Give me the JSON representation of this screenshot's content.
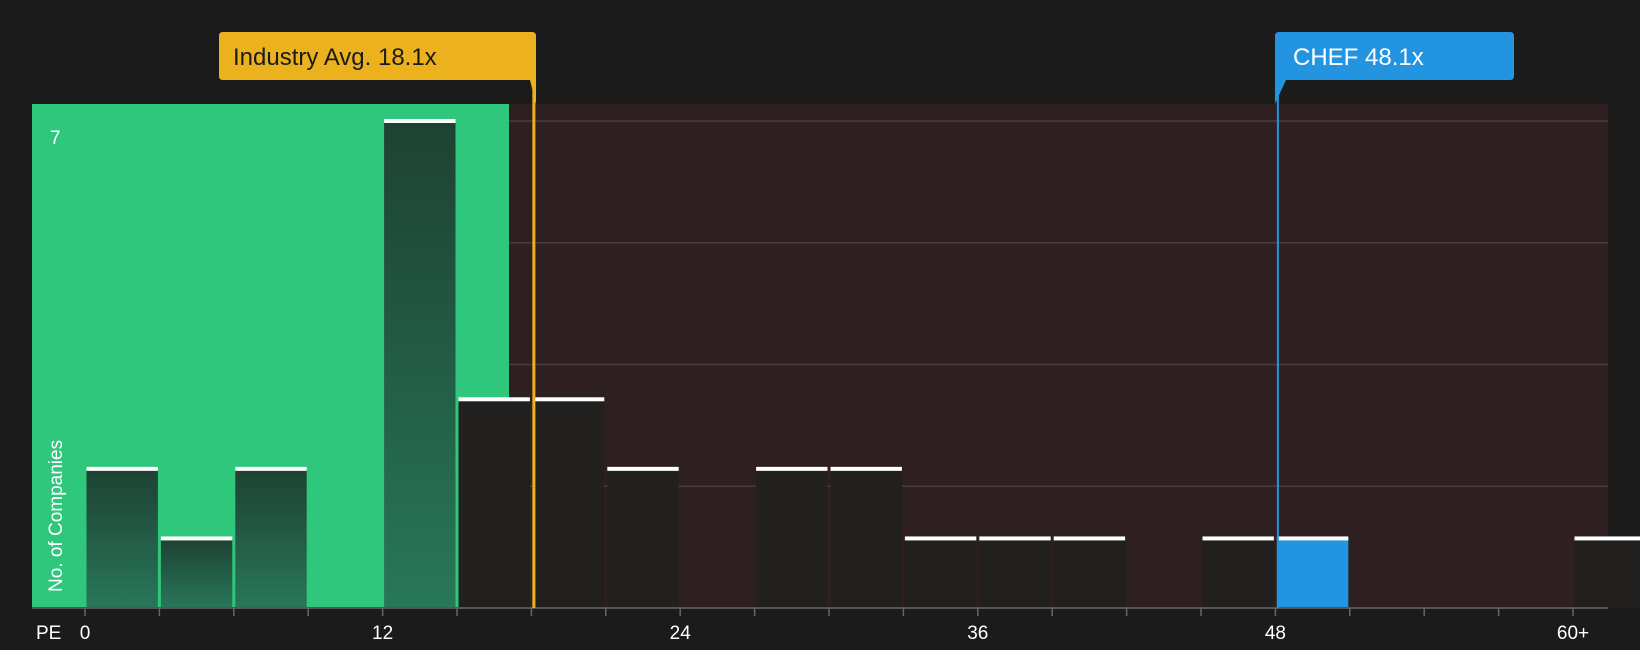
{
  "chart_data": {
    "type": "bar",
    "x_axis_title": "PE",
    "y_axis_title": "No. of Companies",
    "y_max_label": "7",
    "x_ticks": [
      "0",
      "12",
      "24",
      "36",
      "48",
      "60+"
    ],
    "bin_width": 3,
    "ylim": [
      0,
      7
    ],
    "bins": [
      {
        "start": 0,
        "count": 2
      },
      {
        "start": 3,
        "count": 1
      },
      {
        "start": 6,
        "count": 2
      },
      {
        "start": 12,
        "count": 7
      },
      {
        "start": 15,
        "count": 3
      },
      {
        "start": 18,
        "count": 3
      },
      {
        "start": 21,
        "count": 2
      },
      {
        "start": 27,
        "count": 2
      },
      {
        "start": 30,
        "count": 2
      },
      {
        "start": 33,
        "count": 1
      },
      {
        "start": 36,
        "count": 1
      },
      {
        "start": 39,
        "count": 1
      },
      {
        "start": 45,
        "count": 1
      },
      {
        "start": 48,
        "count": 1,
        "highlight": true
      },
      {
        "start": 60,
        "count": 1
      }
    ],
    "industry_avg": {
      "label": "Industry Avg. 18.1x",
      "value": 18.1
    },
    "company": {
      "label": "CHEF 48.1x",
      "value": 48.1
    },
    "colors": {
      "background": "#1b1b1b",
      "green_zone": "#2ec77c",
      "red_zone": "#2e1f20",
      "avg_color": "#ecb21e",
      "company_color": "#2394e0"
    },
    "grid": true
  }
}
